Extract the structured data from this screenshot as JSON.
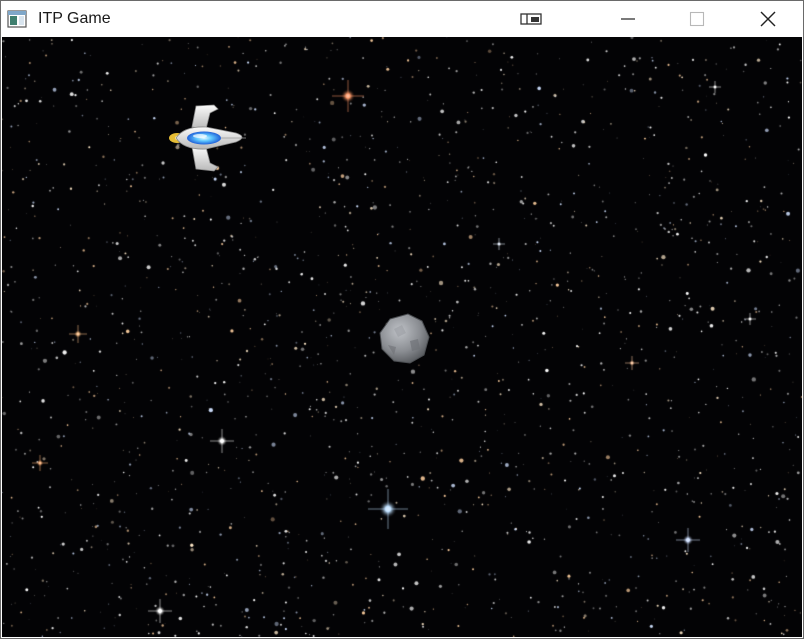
{
  "window": {
    "title": "ITP Game",
    "app_icon": "window-app-icon",
    "controls": {
      "extra": "compact-overlay-icon",
      "minimize": "minimize-icon",
      "maximize": "maximize-icon",
      "close": "close-icon"
    }
  },
  "scene": {
    "background": "starfield",
    "sprites": [
      {
        "name": "spaceship",
        "icon": "spaceship-icon"
      },
      {
        "name": "asteroid",
        "icon": "asteroid-icon"
      }
    ]
  },
  "colors": {
    "space": "#030305",
    "titlebar": "#ffffff",
    "ship_body": "#e6e6e6",
    "ship_cockpit": "#2e8cff",
    "asteroid": "#8a8d92"
  }
}
